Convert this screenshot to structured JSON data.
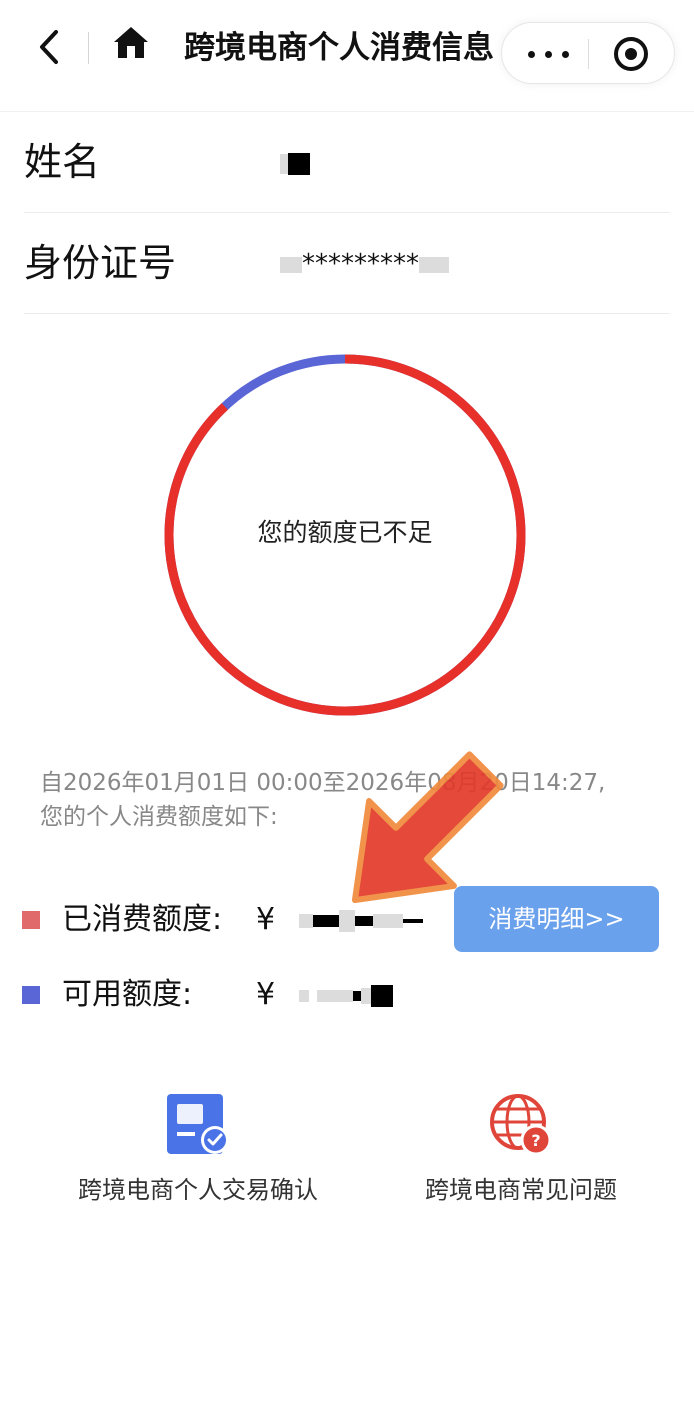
{
  "nav": {
    "title": "跨境电商个人消费信息"
  },
  "info": {
    "name_label": "姓名",
    "id_label": "身份证号",
    "id_stars": "*********"
  },
  "quota": {
    "status_text": "您的额度已不足",
    "period_line1": "自2026年01月01日 00:00至2026年08月20日14:27,",
    "period_line2": "您的个人消费额度如下:",
    "used_label": "已消费额度:",
    "available_label": "可用额度:",
    "currency": "¥",
    "detail_button": "消费明细>>",
    "used_color": "#e06a6a",
    "available_color": "#5b66d6",
    "used_fraction": 0.88
  },
  "services": [
    {
      "label": "跨境电商个人交易确认",
      "icon": "document-check-icon"
    },
    {
      "label": "跨境电商常见问题",
      "icon": "globe-question-icon"
    }
  ]
}
